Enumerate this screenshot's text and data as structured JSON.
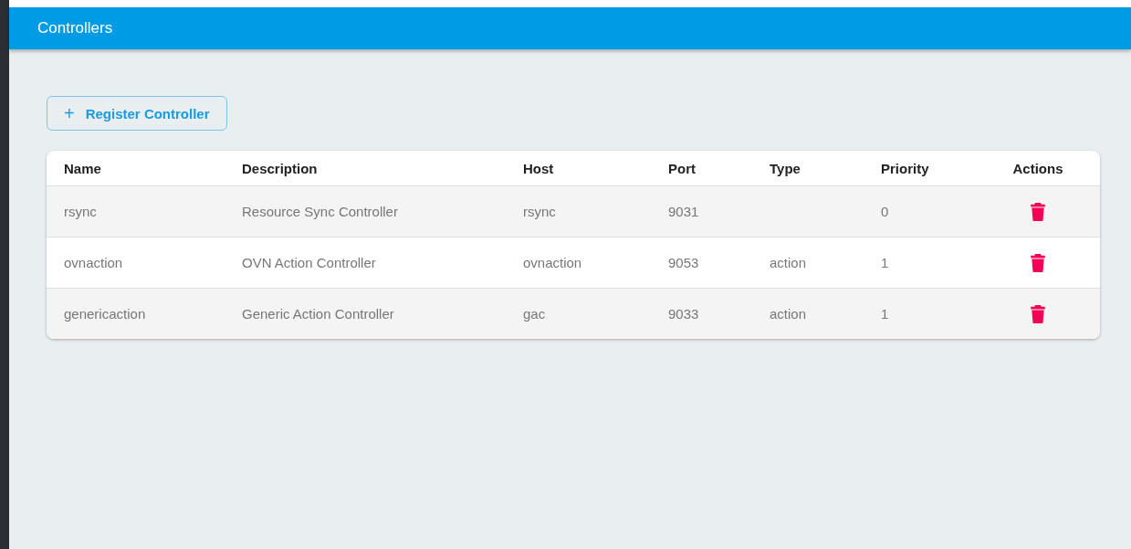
{
  "header": {
    "title": "Controllers"
  },
  "register_button": {
    "icon": "+",
    "label": "Register Controller"
  },
  "table": {
    "columns": [
      "Name",
      "Description",
      "Host",
      "Port",
      "Type",
      "Priority",
      "Actions"
    ],
    "rows": [
      {
        "name": "rsync",
        "description": "Resource Sync Controller",
        "host": "rsync",
        "port": "9031",
        "priority": "0"
      },
      {
        "name": "ovnaction",
        "description": "OVN Action Controller",
        "host": "ovnaction",
        "port": "9053",
        "type": "action",
        "priority": "1"
      },
      {
        "name": "genericaction",
        "description": "Generic Action Controller",
        "host": "gac",
        "port": "9033",
        "type": "action",
        "priority": "1"
      }
    ]
  }
}
